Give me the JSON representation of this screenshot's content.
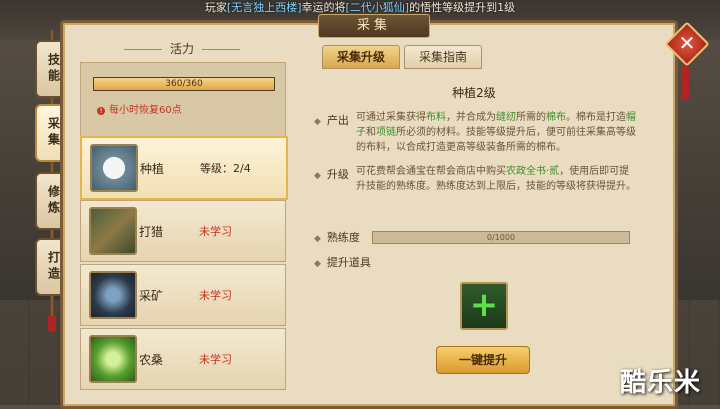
{
  "broadcast": {
    "prefix": "玩家",
    "player": "[无言独上西楼]",
    "middle": "幸运的将",
    "item": "[二代小狐仙]",
    "suffix": "的悟性等级提升到1级"
  },
  "window": {
    "title": "采集"
  },
  "side_tabs": [
    {
      "label": "技能"
    },
    {
      "label": "采集"
    },
    {
      "label": "修炼"
    },
    {
      "label": "打造"
    }
  ],
  "vitality": {
    "title": "活力",
    "current": "360/360",
    "fraction": 1.0,
    "recover_text": "每小时恢复60点"
  },
  "skills": [
    {
      "name": "种植",
      "level_label": "等级：2/4",
      "icon": "cotton-icon"
    },
    {
      "name": "打猎",
      "status": "未学习",
      "icon": "hunting-bow-icon"
    },
    {
      "name": "采矿",
      "status": "未学习",
      "icon": "ore-icon"
    },
    {
      "name": "农桑",
      "status": "未学习",
      "icon": "silkworm-leaf-icon"
    }
  ],
  "tabs": [
    {
      "label": "采集升级"
    },
    {
      "label": "采集指南"
    }
  ],
  "detail": {
    "title": "种植2级",
    "produce_label": "产出",
    "produce_text_1": "可通过采集获得",
    "produce_g1": "布料",
    "produce_text_2": "，并合成为",
    "produce_g2": "缝纫",
    "produce_text_3": "所需的",
    "produce_g3": "棉布",
    "produce_text_4": "。棉布是打造",
    "produce_g4": "帽子",
    "produce_text_5": "和",
    "produce_g5": "项链",
    "produce_text_6": "所必须的材料。技能等级提升后，便可前往采集高等级的布料，以合成打造更高等级装备所需的棉布。",
    "upgrade_label": "升级",
    "upgrade_text_1": "可花费帮会通宝在帮会商店中购买",
    "upgrade_g1": "农政全书·贰",
    "upgrade_text_2": "，使用后即可提升技能的熟练度。熟练度达到上限后，技能的等级将获得提升。",
    "proficiency_label": "熟练度",
    "proficiency_value": "0/1000",
    "proficiency_fraction": 0.0,
    "items_label": "提升道具",
    "upgrade_button": "一键提升"
  },
  "watermark": "酷乐米"
}
